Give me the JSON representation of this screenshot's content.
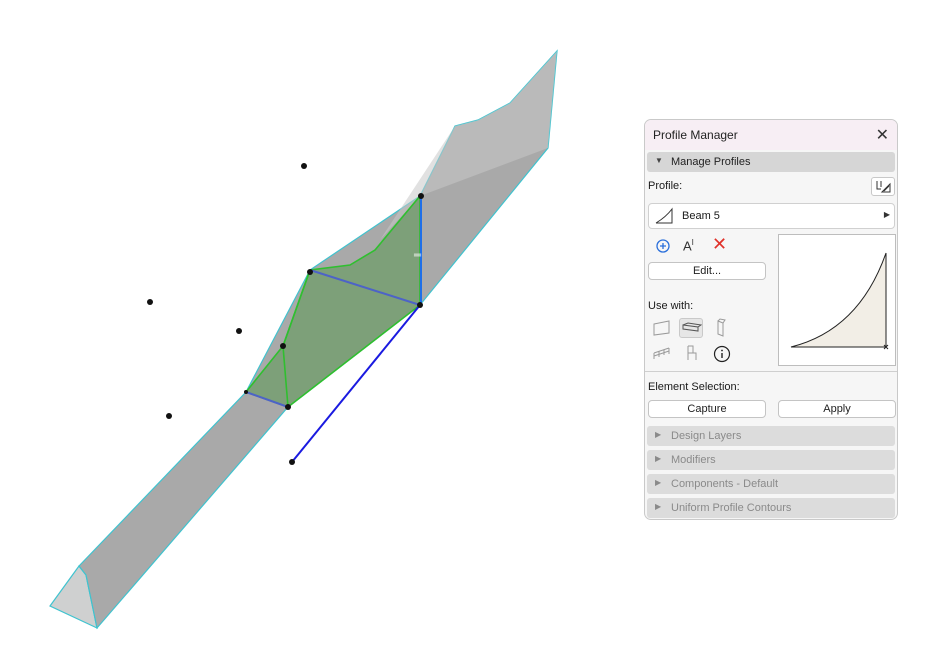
{
  "panel": {
    "title": "Profile Manager",
    "close_icon": "close-icon",
    "manage_profiles_label": "Manage Profiles",
    "profile_label": "Profile:",
    "profile_name": "Beam 5",
    "edit_label": "Edit...",
    "use_with_label": "Use with:",
    "element_selection_label": "Element Selection:",
    "capture_label": "Capture",
    "apply_label": "Apply",
    "collapsed_sections": [
      "Design Layers",
      "Modifiers",
      "Components - Default",
      "Uniform Profile Contours"
    ],
    "icons": {
      "options": "profile-options-icon",
      "add": "add-profile-icon",
      "rename": "rename-icon",
      "delete": "delete-icon",
      "wall": "wall-icon",
      "beam": "beam-icon",
      "column": "column-icon",
      "railing": "railing-icon",
      "object": "object-icon",
      "info": "info-icon"
    }
  },
  "colors": {
    "selection_green": "#2fbf2f",
    "edge_cyan": "#3fc3cf",
    "handle_blue": "#1a1ae0",
    "body_gray": "#a9a9a9"
  }
}
